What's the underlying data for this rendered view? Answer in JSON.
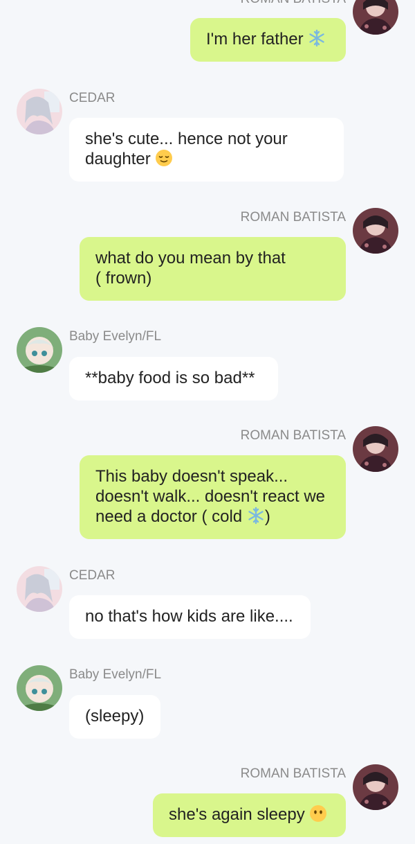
{
  "colors": {
    "background": "#f5f7fa",
    "my_bubble": "#d9f68c",
    "their_bubble": "#ffffff",
    "name_text": "#8a8a8a",
    "message_text": "#222222"
  },
  "messages": [
    {
      "sender": "ROMAN BATISTA",
      "side": "right",
      "text": "I'm her father",
      "emoji": "snowflake-icon"
    },
    {
      "sender": "CEDAR",
      "side": "left",
      "text_lines": [
        "she's cute... hence not your",
        "daughter"
      ],
      "emoji": "relieved-face-icon"
    },
    {
      "sender": "ROMAN BATISTA",
      "side": "right",
      "text_lines": [
        "what do you mean by that",
        "( frown)"
      ]
    },
    {
      "sender": "Baby Evelyn/FL",
      "side": "left",
      "text": "**baby food is so bad**"
    },
    {
      "sender": "ROMAN BATISTA",
      "side": "right",
      "text_lines": [
        "This baby doesn't speak...",
        "doesn't walk... doesn't react we",
        "need a doctor ( cold"
      ],
      "text_tail": ")",
      "emoji": "snowflake-icon"
    },
    {
      "sender": "CEDAR",
      "side": "left",
      "text": "no that's how kids are like...."
    },
    {
      "sender": "Baby Evelyn/FL",
      "side": "left",
      "text": "(sleepy)"
    },
    {
      "sender": "ROMAN BATISTA",
      "side": "right",
      "text": "she's again sleepy",
      "emoji": "face-without-mouth-icon"
    }
  ]
}
